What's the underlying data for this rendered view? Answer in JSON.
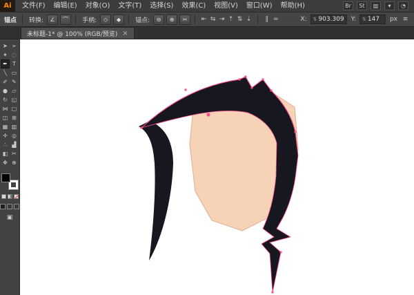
{
  "app": {
    "logo": "Ai",
    "menus": [
      "文件(F)",
      "编辑(E)",
      "对象(O)",
      "文字(T)",
      "选择(S)",
      "效果(C)",
      "视图(V)",
      "窗口(W)",
      "帮助(H)"
    ],
    "right_icons": [
      {
        "name": "brushes-panel-icon",
        "glyph": "Br"
      },
      {
        "name": "styles-panel-icon",
        "glyph": "St"
      },
      {
        "name": "workspace-layout-icon",
        "glyph": "▥"
      },
      {
        "name": "chevron-down-icon",
        "glyph": "▾"
      },
      {
        "name": "cs-live-icon",
        "glyph": "◔"
      }
    ]
  },
  "control_bar": {
    "title": "锚点",
    "groups": [
      {
        "label": "转换:",
        "buttons": [
          {
            "name": "convert-to-corner-button",
            "glyph": "∠"
          },
          {
            "name": "convert-to-smooth-button",
            "glyph": "⌒"
          }
        ]
      },
      {
        "label": "手柄:",
        "buttons": [
          {
            "name": "show-handles-button",
            "glyph": "◇"
          },
          {
            "name": "hide-handles-button",
            "glyph": "◆"
          }
        ]
      },
      {
        "label": "锚点:",
        "buttons": [
          {
            "name": "remove-anchor-button",
            "glyph": "⊖"
          },
          {
            "name": "add-anchor-button",
            "glyph": "⊕"
          },
          {
            "name": "cut-path-button",
            "glyph": "✂"
          }
        ]
      }
    ],
    "align_icons": [
      {
        "name": "align-left-icon",
        "glyph": "⇤"
      },
      {
        "name": "align-h-center-icon",
        "glyph": "⇆"
      },
      {
        "name": "align-right-icon",
        "glyph": "⇥"
      },
      {
        "name": "align-top-icon",
        "glyph": "⇡"
      },
      {
        "name": "align-v-center-icon",
        "glyph": "⇅"
      },
      {
        "name": "align-bottom-icon",
        "glyph": "⇣"
      }
    ],
    "distribute_icons": [
      {
        "name": "distribute-h-icon",
        "glyph": "∥"
      },
      {
        "name": "distribute-v-icon",
        "glyph": "="
      }
    ],
    "x_label": "X:",
    "x_value": "903.309",
    "y_label": "Y:",
    "y_value": "147",
    "unit": "px",
    "stepper": "⇅",
    "panel_menu": "≡"
  },
  "tab": {
    "title": "未标题-1* @ 100% (RGB/预览)",
    "close": "×"
  },
  "tools": [
    {
      "name": "selection-tool",
      "glyph": "➤"
    },
    {
      "name": "direct-selection-tool",
      "glyph": "➢"
    },
    {
      "name": "magic-wand-tool",
      "glyph": "✦"
    },
    {
      "name": "lasso-tool",
      "glyph": "◌"
    },
    {
      "name": "pen-tool",
      "glyph": "✒",
      "active": true
    },
    {
      "name": "type-tool",
      "glyph": "T"
    },
    {
      "name": "line-tool",
      "glyph": "╲"
    },
    {
      "name": "rectangle-tool",
      "glyph": "▭"
    },
    {
      "name": "paintbrush-tool",
      "glyph": "✐"
    },
    {
      "name": "pencil-tool",
      "glyph": "✎"
    },
    {
      "name": "blob-brush-tool",
      "glyph": "●"
    },
    {
      "name": "eraser-tool",
      "glyph": "▱"
    },
    {
      "name": "rotate-tool",
      "glyph": "↻"
    },
    {
      "name": "scale-tool",
      "glyph": "◱"
    },
    {
      "name": "width-tool",
      "glyph": "⋈"
    },
    {
      "name": "free-transform-tool",
      "glyph": "▢"
    },
    {
      "name": "shape-builder-tool",
      "glyph": "◫"
    },
    {
      "name": "perspective-grid-tool",
      "glyph": "⊞"
    },
    {
      "name": "mesh-tool",
      "glyph": "▦"
    },
    {
      "name": "gradient-tool",
      "glyph": "▥"
    },
    {
      "name": "eyedropper-tool",
      "glyph": "✛"
    },
    {
      "name": "blend-tool",
      "glyph": "◎"
    },
    {
      "name": "symbol-sprayer-tool",
      "glyph": "∴"
    },
    {
      "name": "column-graph-tool",
      "glyph": "▟"
    },
    {
      "name": "artboard-tool",
      "glyph": "◧"
    },
    {
      "name": "slice-tool",
      "glyph": "✂"
    },
    {
      "name": "hand-tool",
      "glyph": "✥"
    },
    {
      "name": "zoom-tool",
      "glyph": "⊕"
    }
  ],
  "artwork": {
    "hair_color": "#17171f",
    "skin_color": "#f6d2b6",
    "face_outline": "#e3ab92",
    "selection_color": "#ff4d8c"
  }
}
